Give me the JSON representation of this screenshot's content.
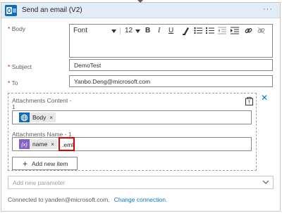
{
  "header": {
    "title": "Send an email (V2)",
    "app_icon": "outlook-icon",
    "more_label": "···"
  },
  "fields": {
    "body_label": "Body",
    "subject_label": "Subject",
    "subject_value": "DemoTest",
    "to_label": "To",
    "to_value": "Yanbo.Deng@microsoft.com",
    "required_mark": "*"
  },
  "toolbar": {
    "font": "Font",
    "size": "12",
    "bold": "B",
    "italic": "I",
    "underline": "U"
  },
  "attachments": {
    "content_label_line1": "Attachments Content -",
    "content_label_line2": "1",
    "content_token": "Body",
    "name_label": "Attachments Name - 1",
    "name_token": "name",
    "name_suffix": ".eml",
    "token_remove": "×",
    "add_item": "Add new item",
    "add_icon": "plus-icon"
  },
  "params": {
    "placeholder": "Add new parameter"
  },
  "footer": {
    "connected_text": "Connected to yanden@microsoft.com.",
    "change_link": "Change connection."
  },
  "colors": {
    "header_bg": "#e1ecf7",
    "outlook_blue": "#0f6cbd",
    "link": "#0078d4",
    "highlight": "#e00000",
    "expression_purple": "#8661c5",
    "content_blue": "#0f6cbd"
  }
}
